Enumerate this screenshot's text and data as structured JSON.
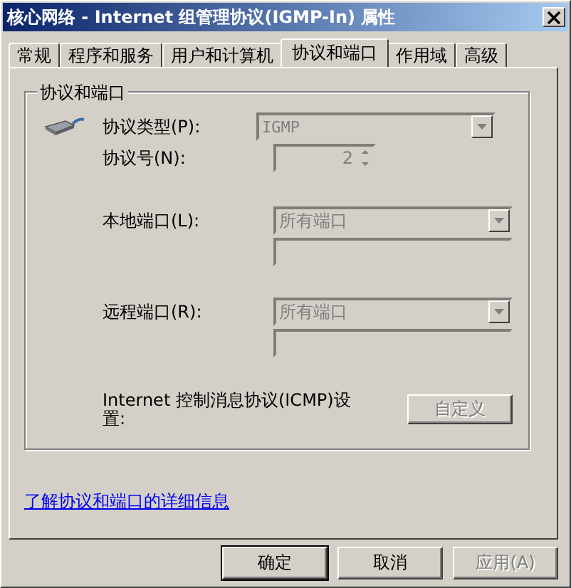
{
  "window": {
    "title": "核心网络 - Internet 组管理协议(IGMP-In) 属性"
  },
  "tabs": [
    {
      "label": "常规",
      "selected": false
    },
    {
      "label": "程序和服务",
      "selected": false
    },
    {
      "label": "用户和计算机",
      "selected": false
    },
    {
      "label": "协议和端口",
      "selected": true
    },
    {
      "label": "作用域",
      "selected": false
    },
    {
      "label": "高级",
      "selected": false
    }
  ],
  "group": {
    "title": "协议和端口",
    "protocol_type": {
      "label": "协议类型(P):",
      "value": "IGMP",
      "disabled": true
    },
    "protocol_number": {
      "label": "协议号(N):",
      "value": "2",
      "disabled": true
    },
    "local_port": {
      "label": "本地端口(L):",
      "value": "所有端口",
      "disabled": true
    },
    "remote_port": {
      "label": "远程端口(R):",
      "value": "所有端口",
      "disabled": true
    },
    "icmp": {
      "label": "Internet 控制消息协议(ICMP)设置:",
      "button": {
        "label": "自定义",
        "disabled": true
      }
    }
  },
  "link": "了解协议和端口的详细信息",
  "buttons": [
    {
      "label": "确定",
      "kind": "default",
      "disabled": false
    },
    {
      "label": "取消",
      "kind": "normal",
      "disabled": false
    },
    {
      "label": "应用(A)",
      "kind": "normal",
      "disabled": true
    }
  ]
}
